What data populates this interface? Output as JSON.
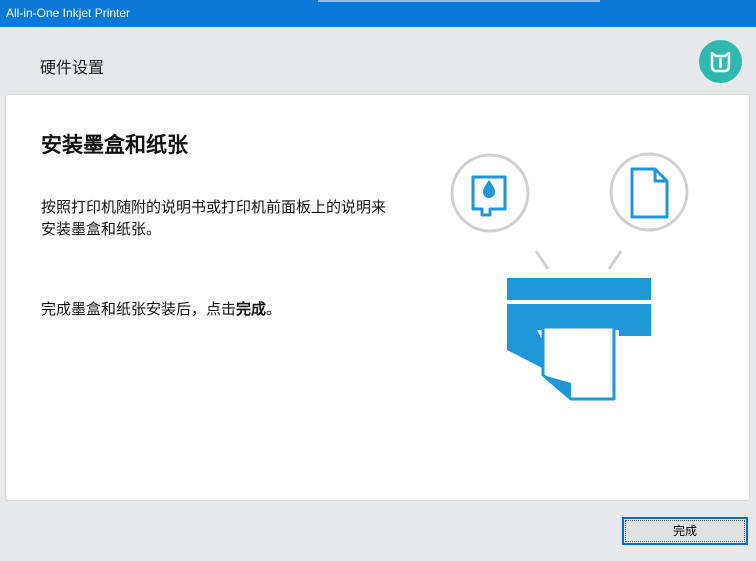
{
  "window": {
    "title": "All-in-One Inkjet Printer"
  },
  "header": {
    "title": "硬件设置",
    "logo_icon": "mi-home-logo-icon",
    "logo_color": "#2fb8b0"
  },
  "card": {
    "title": "安装墨盒和纸张",
    "description": "按照打印机随附的说明书或打印机前面板上的说明来安装墨盒和纸张。",
    "note_prefix": "完成墨盒和纸张安装后，点击",
    "note_emphasis": "完成",
    "note_suffix": "。",
    "illustration": {
      "icons": [
        "ink-cartridge-icon",
        "paper-sheet-icon",
        "printer-icon"
      ],
      "accent_color": "#1e96d8"
    }
  },
  "footer": {
    "finish_label": "完成"
  },
  "colors": {
    "titlebar": "#0a78d7",
    "background": "#e6e8ea",
    "card": "#ffffff",
    "button_border": "#0a6cc9"
  }
}
